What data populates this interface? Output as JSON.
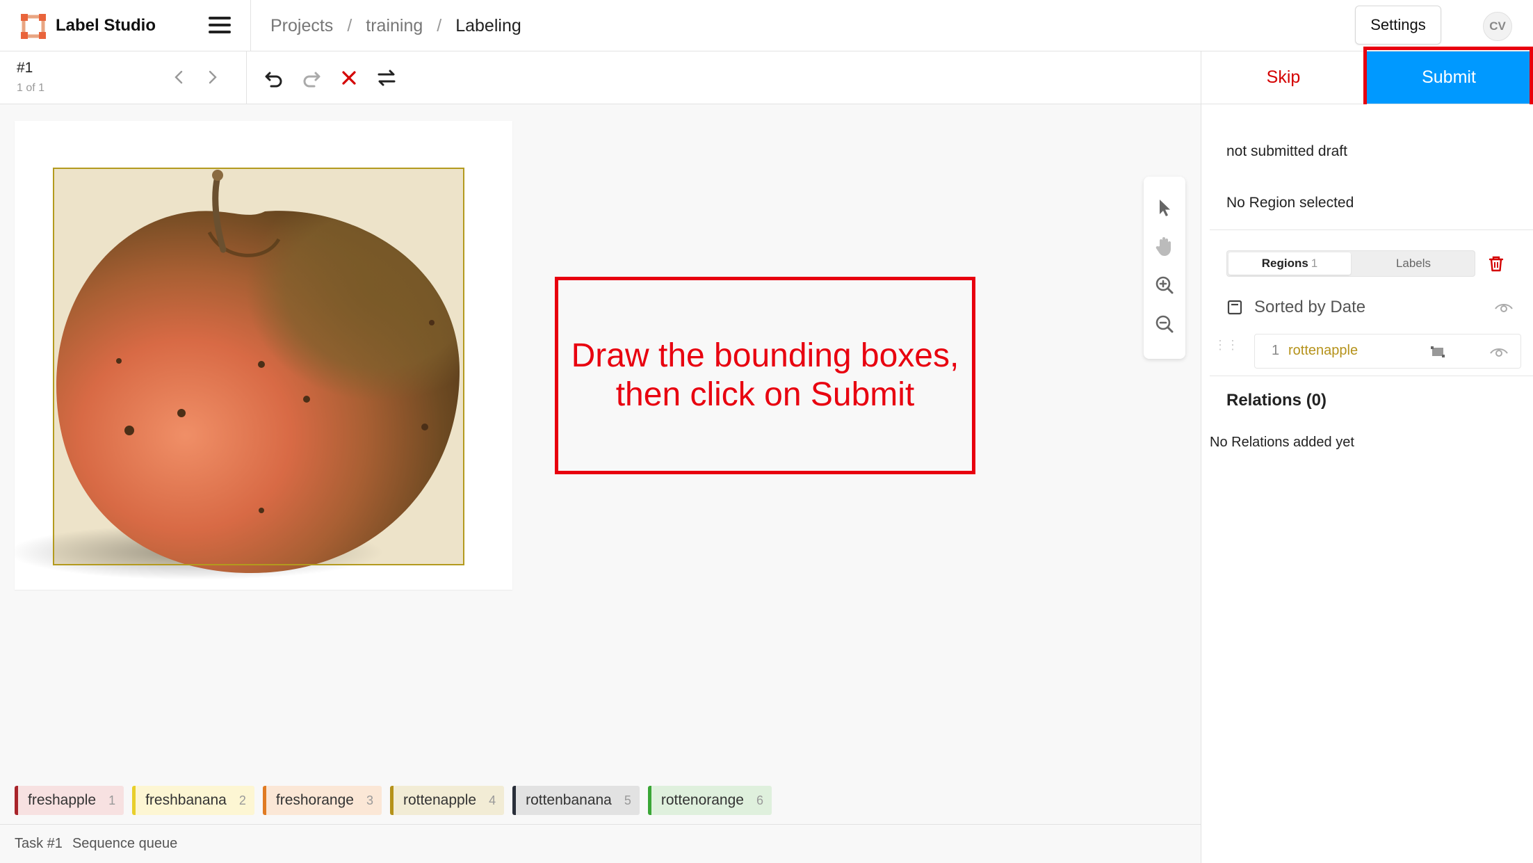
{
  "app": {
    "title": "Label Studio",
    "menu_icon": "hamburger-icon"
  },
  "breadcrumb": {
    "items": [
      "Projects",
      "training",
      "Labeling"
    ],
    "separator": "/"
  },
  "header": {
    "settings_label": "Settings",
    "avatar_initials": "CV"
  },
  "task": {
    "id_label": "#1",
    "count_label": "1 of 1"
  },
  "toolbar": {
    "icons": [
      "chevron-left-icon",
      "chevron-right-icon",
      "undo-icon",
      "redo-icon",
      "reset-icon",
      "swap-icon"
    ]
  },
  "actions": {
    "skip_label": "Skip",
    "submit_label": "Submit",
    "submit_color": "#0099ff",
    "skip_color": "#d40000"
  },
  "instruction": {
    "line1": "Draw the bounding boxes,",
    "line2": "then click on Submit",
    "color": "#e8000f"
  },
  "tools": [
    "pointer-icon",
    "hand-pan-icon",
    "zoom-in-icon",
    "zoom-out-icon"
  ],
  "labels": [
    {
      "name": "freshapple",
      "hotkey": "1",
      "color": "#a8242a",
      "bg": "#f7e1e1"
    },
    {
      "name": "freshbanana",
      "hotkey": "2",
      "color": "#e8cf2b",
      "bg": "#fdf6d3"
    },
    {
      "name": "freshorange",
      "hotkey": "3",
      "color": "#e07b23",
      "bg": "#fbe7d6"
    },
    {
      "name": "rottenapple",
      "hotkey": "4",
      "color": "#b5921a",
      "bg": "#f2ecd5"
    },
    {
      "name": "rottenbanana",
      "hotkey": "5",
      "color": "#2a2f3a",
      "bg": "#e2e2e2"
    },
    {
      "name": "rottenorange",
      "hotkey": "6",
      "color": "#3aa636",
      "bg": "#dff0dd"
    }
  ],
  "footer": {
    "task_label": "Task #1",
    "queue_label": "Sequence queue"
  },
  "sidebar": {
    "draft_status": "not submitted draft",
    "region_status": "No Region selected",
    "tab_regions_label": "Regions",
    "tab_regions_count": "1",
    "tab_labels_label": "Labels",
    "sort_label": "Sorted by Date",
    "regions": [
      {
        "index": "1",
        "label": "rottenapple"
      }
    ],
    "relations_title": "Relations (0)",
    "relations_empty": "No Relations added yet"
  }
}
